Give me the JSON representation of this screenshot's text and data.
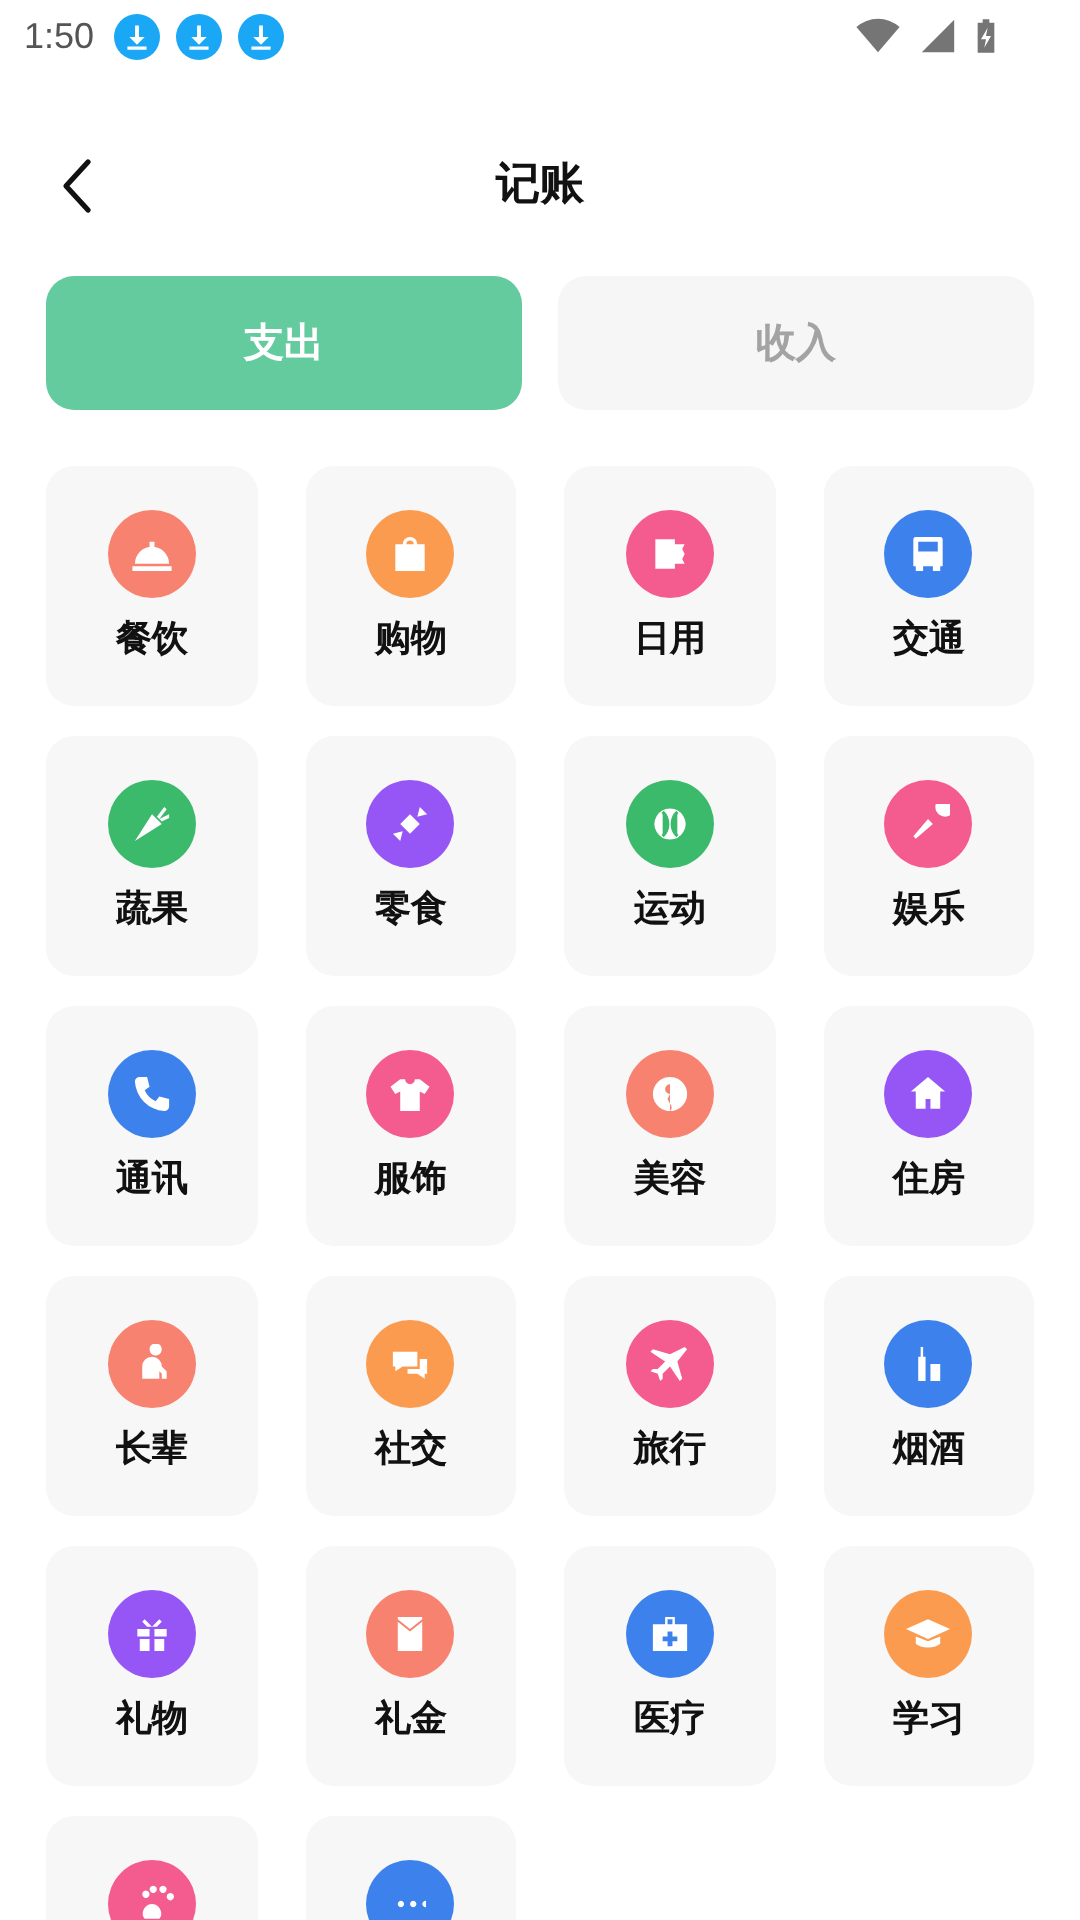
{
  "status_bar": {
    "time": "1:50",
    "notifications": [
      {
        "kind": "download"
      },
      {
        "kind": "download"
      },
      {
        "kind": "download"
      }
    ]
  },
  "header": {
    "title": "记账"
  },
  "tabs": [
    {
      "label": "支出",
      "selected": true
    },
    {
      "label": "收入",
      "selected": false
    }
  ],
  "categories": [
    {
      "label": "餐饮",
      "kind": "cloche",
      "color": "#f7826f"
    },
    {
      "label": "购物",
      "kind": "bag",
      "color": "#fb9b50"
    },
    {
      "label": "日用",
      "kind": "roll",
      "color": "#f45b8f"
    },
    {
      "label": "交通",
      "kind": "bus",
      "color": "#3d82ec"
    },
    {
      "label": "蔬果",
      "kind": "carrot",
      "color": "#3cba6b"
    },
    {
      "label": "零食",
      "kind": "candy",
      "color": "#9655f5"
    },
    {
      "label": "运动",
      "kind": "ball",
      "color": "#3cba6b"
    },
    {
      "label": "娱乐",
      "kind": "mic",
      "color": "#f45b8f"
    },
    {
      "label": "通讯",
      "kind": "phone",
      "color": "#3d82ec"
    },
    {
      "label": "服饰",
      "kind": "shirt",
      "color": "#f45b8f"
    },
    {
      "label": "美容",
      "kind": "face",
      "color": "#f7826f"
    },
    {
      "label": "住房",
      "kind": "house",
      "color": "#9655f5"
    },
    {
      "label": "长辈",
      "kind": "elder",
      "color": "#f7826f"
    },
    {
      "label": "社交",
      "kind": "chat",
      "color": "#fb9b50"
    },
    {
      "label": "旅行",
      "kind": "plane",
      "color": "#f45b8f"
    },
    {
      "label": "烟酒",
      "kind": "bottle",
      "color": "#3d82ec"
    },
    {
      "label": "礼物",
      "kind": "gift",
      "color": "#9655f5"
    },
    {
      "label": "礼金",
      "kind": "envelope",
      "color": "#f7826f"
    },
    {
      "label": "医疗",
      "kind": "medkit",
      "color": "#3d82ec"
    },
    {
      "label": "学习",
      "kind": "cap",
      "color": "#fb9b50"
    },
    {
      "kind": "paw",
      "color": "#f45b8f"
    },
    {
      "kind": "dots",
      "color": "#3d82ec"
    }
  ]
}
